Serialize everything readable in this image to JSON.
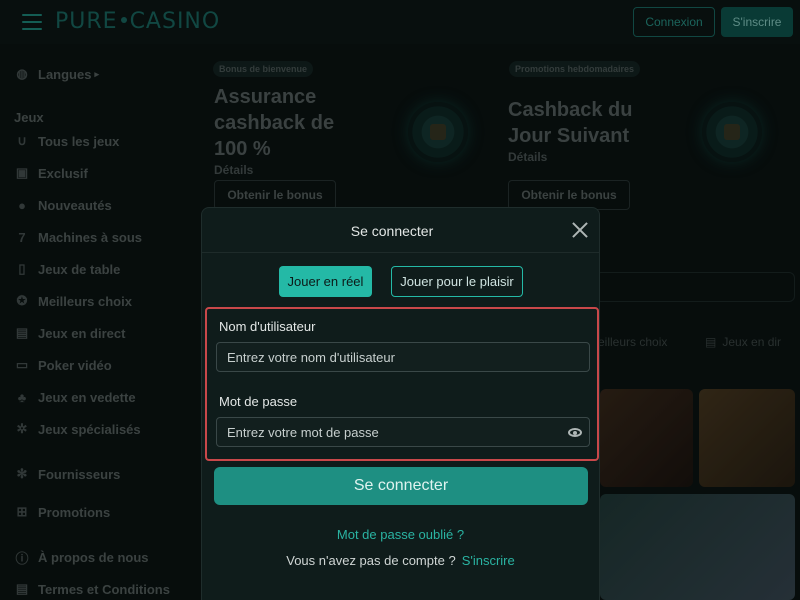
{
  "header": {
    "logo_left": "PURE",
    "logo_right": "CASINO",
    "login_label": "Connexion",
    "signup_label": "S'inscrire"
  },
  "sidebar": {
    "languages_label": "Langues",
    "games_section": "Jeux",
    "items": [
      {
        "label": "Tous les jeux",
        "icon": "horseshoe-icon"
      },
      {
        "label": "Exclusif",
        "icon": "exclusive-icon"
      },
      {
        "label": "Nouveautés",
        "icon": "cherries-icon"
      },
      {
        "label": "Machines à sous",
        "icon": "seven-icon"
      },
      {
        "label": "Jeux de table",
        "icon": "card-icon"
      },
      {
        "label": "Meilleurs choix",
        "icon": "award-icon"
      },
      {
        "label": "Jeux en direct",
        "icon": "live-icon"
      },
      {
        "label": "Poker vidéo",
        "icon": "monitor-icon"
      },
      {
        "label": "Jeux en vedette",
        "icon": "clover-icon"
      },
      {
        "label": "Jeux spécialisés",
        "icon": "gear-icon"
      }
    ],
    "providers_label": "Fournisseurs",
    "promotions_label": "Promotions",
    "about_label": "À propos de nous",
    "terms_label": "Termes et Conditions"
  },
  "promos": [
    {
      "badge": "Bonus de bienvenue",
      "title_lines": [
        "Assurance",
        "cashback de",
        "100 %"
      ],
      "details": "Détails",
      "button": "Obtenir le bonus"
    },
    {
      "badge": "Promotions hebdomadaires",
      "title_lines": [
        "Cashback du",
        "Jour Suivant"
      ],
      "details": "Détails",
      "button": "Obtenir le bonus"
    }
  ],
  "bg_tabs": [
    "eilleurs choix",
    "Jeux en dir"
  ],
  "modal": {
    "title": "Se connecter",
    "mode_real": "Jouer en réel",
    "mode_fun": "Jouer pour le plaisir",
    "username_label": "Nom d'utilisateur",
    "username_placeholder": "Entrez votre nom d'utilisateur",
    "password_label": "Mot de passe",
    "password_placeholder": "Entrez votre mot de passe",
    "submit_label": "Se connecter",
    "forgot_label": "Mot de passe oublié ?",
    "no_account_label": "Vous n'avez pas de compte ?",
    "signup_link": "S'inscrire"
  },
  "colors": {
    "accent": "#24b9a6",
    "highlight_border": "#c9484a",
    "background": "#0b1413"
  }
}
